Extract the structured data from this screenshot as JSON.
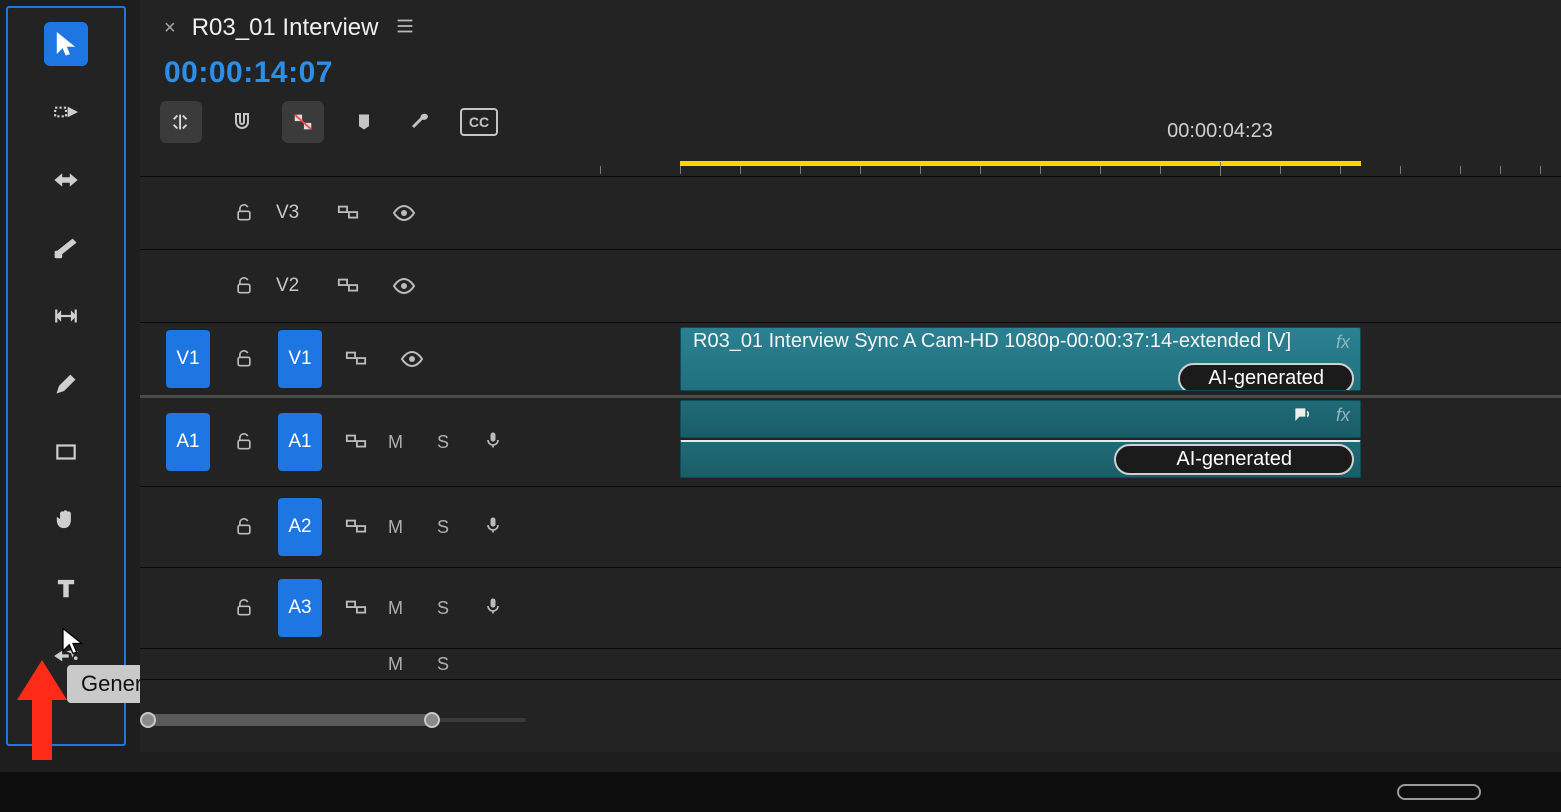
{
  "sequence": {
    "close": "×",
    "name": "R03_01 Interview",
    "timecode": "00:00:14:07",
    "ruler_label": "00:00:04:23"
  },
  "tools": {
    "selection": "Selection Tool",
    "track_select": "Track Select",
    "ripple": "Ripple Edit",
    "razor": "Razor",
    "slip": "Slip",
    "pen": "Pen",
    "rectangle": "Rectangle",
    "hand": "Hand",
    "type": "Type",
    "gen_extend": "Generative Extend"
  },
  "tooltip": "Generative Extend Tool",
  "cc_label": "CC",
  "tracks": {
    "v3": {
      "label": "V3"
    },
    "v2": {
      "label": "V2"
    },
    "v1": {
      "source": "V1",
      "label": "V1",
      "clip": "R03_01 Interview Sync A Cam-HD 1080p-00:00:37:14-extended [V]",
      "ai": "AI-generated",
      "fx": "fx"
    },
    "a1": {
      "source": "A1",
      "label": "A1",
      "m": "M",
      "s": "S",
      "ai": "AI-generated",
      "fx": "fx"
    },
    "a2": {
      "label": "A2",
      "m": "M",
      "s": "S"
    },
    "a3": {
      "label": "A3",
      "m": "M",
      "s": "S"
    },
    "a4": {
      "m": "M",
      "s": "S"
    }
  }
}
